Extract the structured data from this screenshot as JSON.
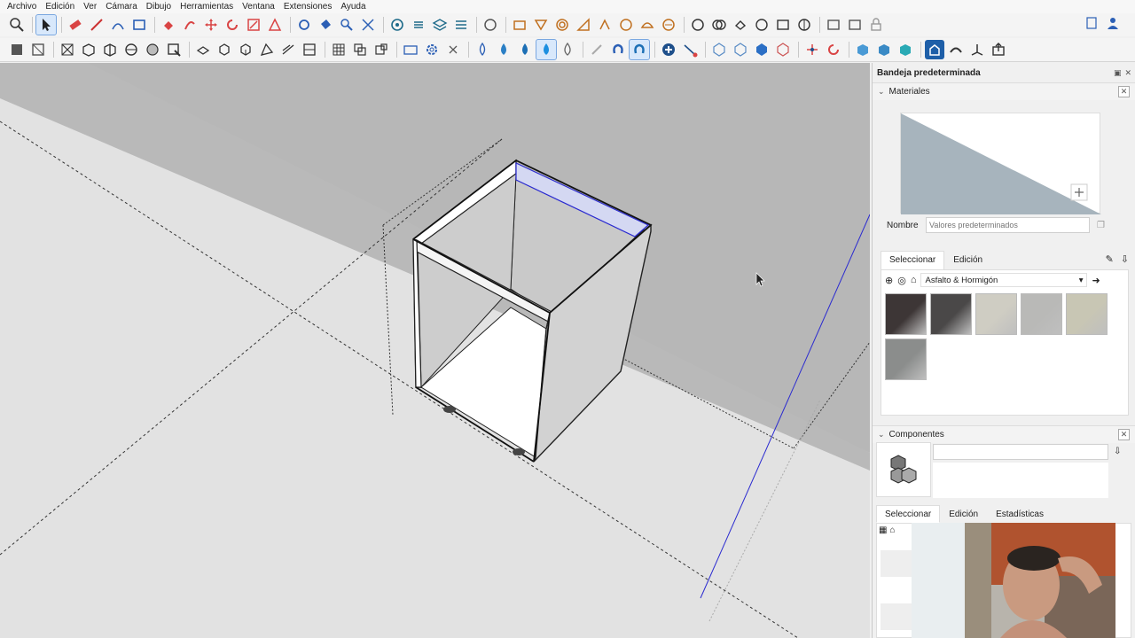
{
  "menu": [
    "Archivo",
    "Edición",
    "Ver",
    "Cámara",
    "Dibujo",
    "Herramientas",
    "Ventana",
    "Extensiones",
    "Ayuda"
  ],
  "tray": {
    "title": "Bandeja predeterminada",
    "materials": {
      "header": "Materiales",
      "name_label": "Nombre",
      "name_placeholder": "Valores predeterminados",
      "tab_select": "Seleccionar",
      "tab_edit": "Edición",
      "library": "Asfalto & Hormigón",
      "swatch_colors": [
        "#3d3636",
        "#4a4848",
        "#cfcdc3",
        "#b9b9b7",
        "#c8c6b4",
        "#8b8d8c"
      ]
    },
    "components": {
      "header": "Componentes",
      "tab_select": "Seleccionar",
      "tab_edit": "Edición",
      "tab_stats": "Estadísticas"
    }
  },
  "colors": {
    "accent": "#1e5fa8",
    "axis_blue": "#2a2ad0",
    "shadow_gray": "#b5b5b5"
  }
}
